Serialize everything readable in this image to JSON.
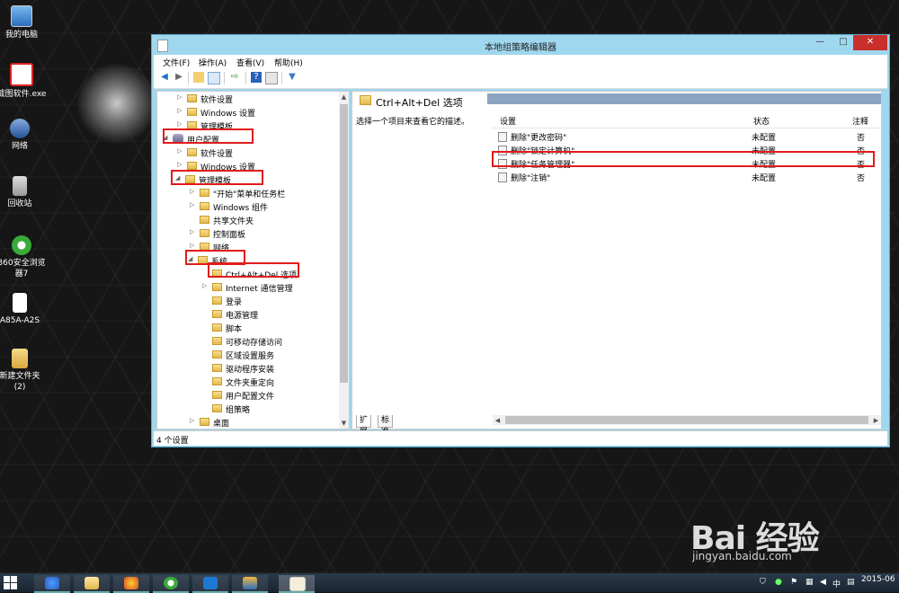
{
  "desktop": {
    "icons": [
      {
        "label": "我的电脑",
        "icon": "computer-icon"
      },
      {
        "label": "截图软件.exe",
        "icon": "app-icon"
      },
      {
        "label": "网络",
        "icon": "network-icon"
      },
      {
        "label": "回收站",
        "icon": "recycle-bin-icon"
      },
      {
        "label": "360安全浏览器7",
        "icon": "browser-icon"
      },
      {
        "label": "A85A-A2S",
        "icon": "file-icon"
      },
      {
        "label": "新建文件夹 (2)",
        "icon": "folder-icon"
      }
    ],
    "watermark": {
      "logo": "Bai 经验",
      "url": "jingyan.baidu.com"
    }
  },
  "window": {
    "title": "本地组策略编辑器",
    "controls": {
      "minimize": "—",
      "maximize": "□",
      "close": "✕"
    },
    "menu": [
      "文件(F)",
      "操作(A)",
      "查看(V)",
      "帮助(H)"
    ],
    "toolbar_icons": [
      "back-icon",
      "forward-icon",
      "up-folder-icon",
      "show-hide-tree-icon",
      "export-icon",
      "help-icon",
      "properties-icon",
      "filter-icon"
    ],
    "tree": [
      {
        "label": "软件设置",
        "arrow": "▷",
        "level": 2
      },
      {
        "label": "Windows 设置",
        "arrow": "▷",
        "level": 2
      },
      {
        "label": "管理模板",
        "arrow": "▷",
        "level": 2
      },
      {
        "label": "用户配置",
        "arrow": "◢",
        "level": 0
      },
      {
        "label": "软件设置",
        "arrow": "▷",
        "level": 2
      },
      {
        "label": "Windows 设置",
        "arrow": "▷",
        "level": 2
      },
      {
        "label": "管理模板",
        "arrow": "◢",
        "level": 1
      },
      {
        "label": "\"开始\"菜单和任务栏",
        "arrow": "▷",
        "level": 3
      },
      {
        "label": "Windows 组件",
        "arrow": "▷",
        "level": 3
      },
      {
        "label": "共享文件夹",
        "arrow": "",
        "level": 3
      },
      {
        "label": "控制面板",
        "arrow": "▷",
        "level": 3
      },
      {
        "label": "网络",
        "arrow": "▷",
        "level": 3
      },
      {
        "label": "系统",
        "arrow": "◢",
        "level": 2
      },
      {
        "label": "Ctrl+Alt+Del 选项",
        "arrow": "",
        "level": 4
      },
      {
        "label": "Internet 通信管理",
        "arrow": "▷",
        "level": 4
      },
      {
        "label": "登录",
        "arrow": "",
        "level": 4
      },
      {
        "label": "电源管理",
        "arrow": "",
        "level": 4
      },
      {
        "label": "脚本",
        "arrow": "",
        "level": 4
      },
      {
        "label": "可移动存储访问",
        "arrow": "",
        "level": 4
      },
      {
        "label": "区域设置服务",
        "arrow": "",
        "level": 4
      },
      {
        "label": "驱动程序安装",
        "arrow": "",
        "level": 4
      },
      {
        "label": "文件夹重定向",
        "arrow": "",
        "level": 4
      },
      {
        "label": "用户配置文件",
        "arrow": "",
        "level": 4
      },
      {
        "label": "组策略",
        "arrow": "",
        "level": 4
      },
      {
        "label": "桌面",
        "arrow": "▷",
        "level": 3
      }
    ],
    "right": {
      "title": "Ctrl+Alt+Del 选项",
      "description": "选择一个项目来查看它的描述。",
      "columns": {
        "setting": "设置",
        "state": "状态",
        "comment": "注释"
      },
      "rows": [
        {
          "setting": "删除\"更改密码\"",
          "state": "未配置",
          "comment": "否"
        },
        {
          "setting": "删除\"锁定计算机\"",
          "state": "未配置",
          "comment": "否"
        },
        {
          "setting": "删除\"任务管理器\"",
          "state": "未配置",
          "comment": "否"
        },
        {
          "setting": "删除\"注销\"",
          "state": "未配置",
          "comment": "否"
        }
      ]
    },
    "tabs": [
      "扩展",
      "标准"
    ],
    "status": "4 个设置"
  },
  "taskbar": {
    "apps": [
      "explorer-icon",
      "qq-icon",
      "browser-icon",
      "defender-icon",
      "store-icon",
      "document-icon"
    ],
    "tray": {
      "ime": "中",
      "date": "2015-06"
    }
  }
}
